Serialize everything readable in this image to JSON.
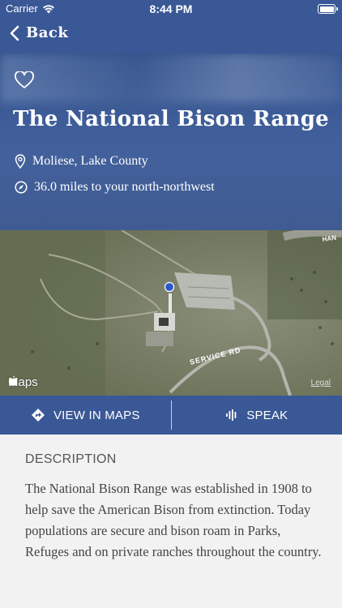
{
  "status": {
    "carrier": "Carrier",
    "time": "8:44 PM"
  },
  "nav": {
    "back_label": "Back"
  },
  "place": {
    "title": "The National Bison Range",
    "location": "Moliese, Lake County",
    "distance": "36.0 miles to your north-northwest"
  },
  "map": {
    "logo": "Maps",
    "legal": "Legal",
    "road_label": "SERVICE RD",
    "road_label_top": "HAN"
  },
  "actions": {
    "view_in_maps": "VIEW IN MAPS",
    "speak": "SPEAK"
  },
  "description": {
    "heading": "DESCRIPTION",
    "body": "The National Bison Range was established in 1908 to help save the American Bison from extinction. Today populations are secure and bison roam in Parks, Refuges and on private ranches throughout the country."
  },
  "colors": {
    "brand": "#3a5896",
    "text_dark": "#444444"
  }
}
